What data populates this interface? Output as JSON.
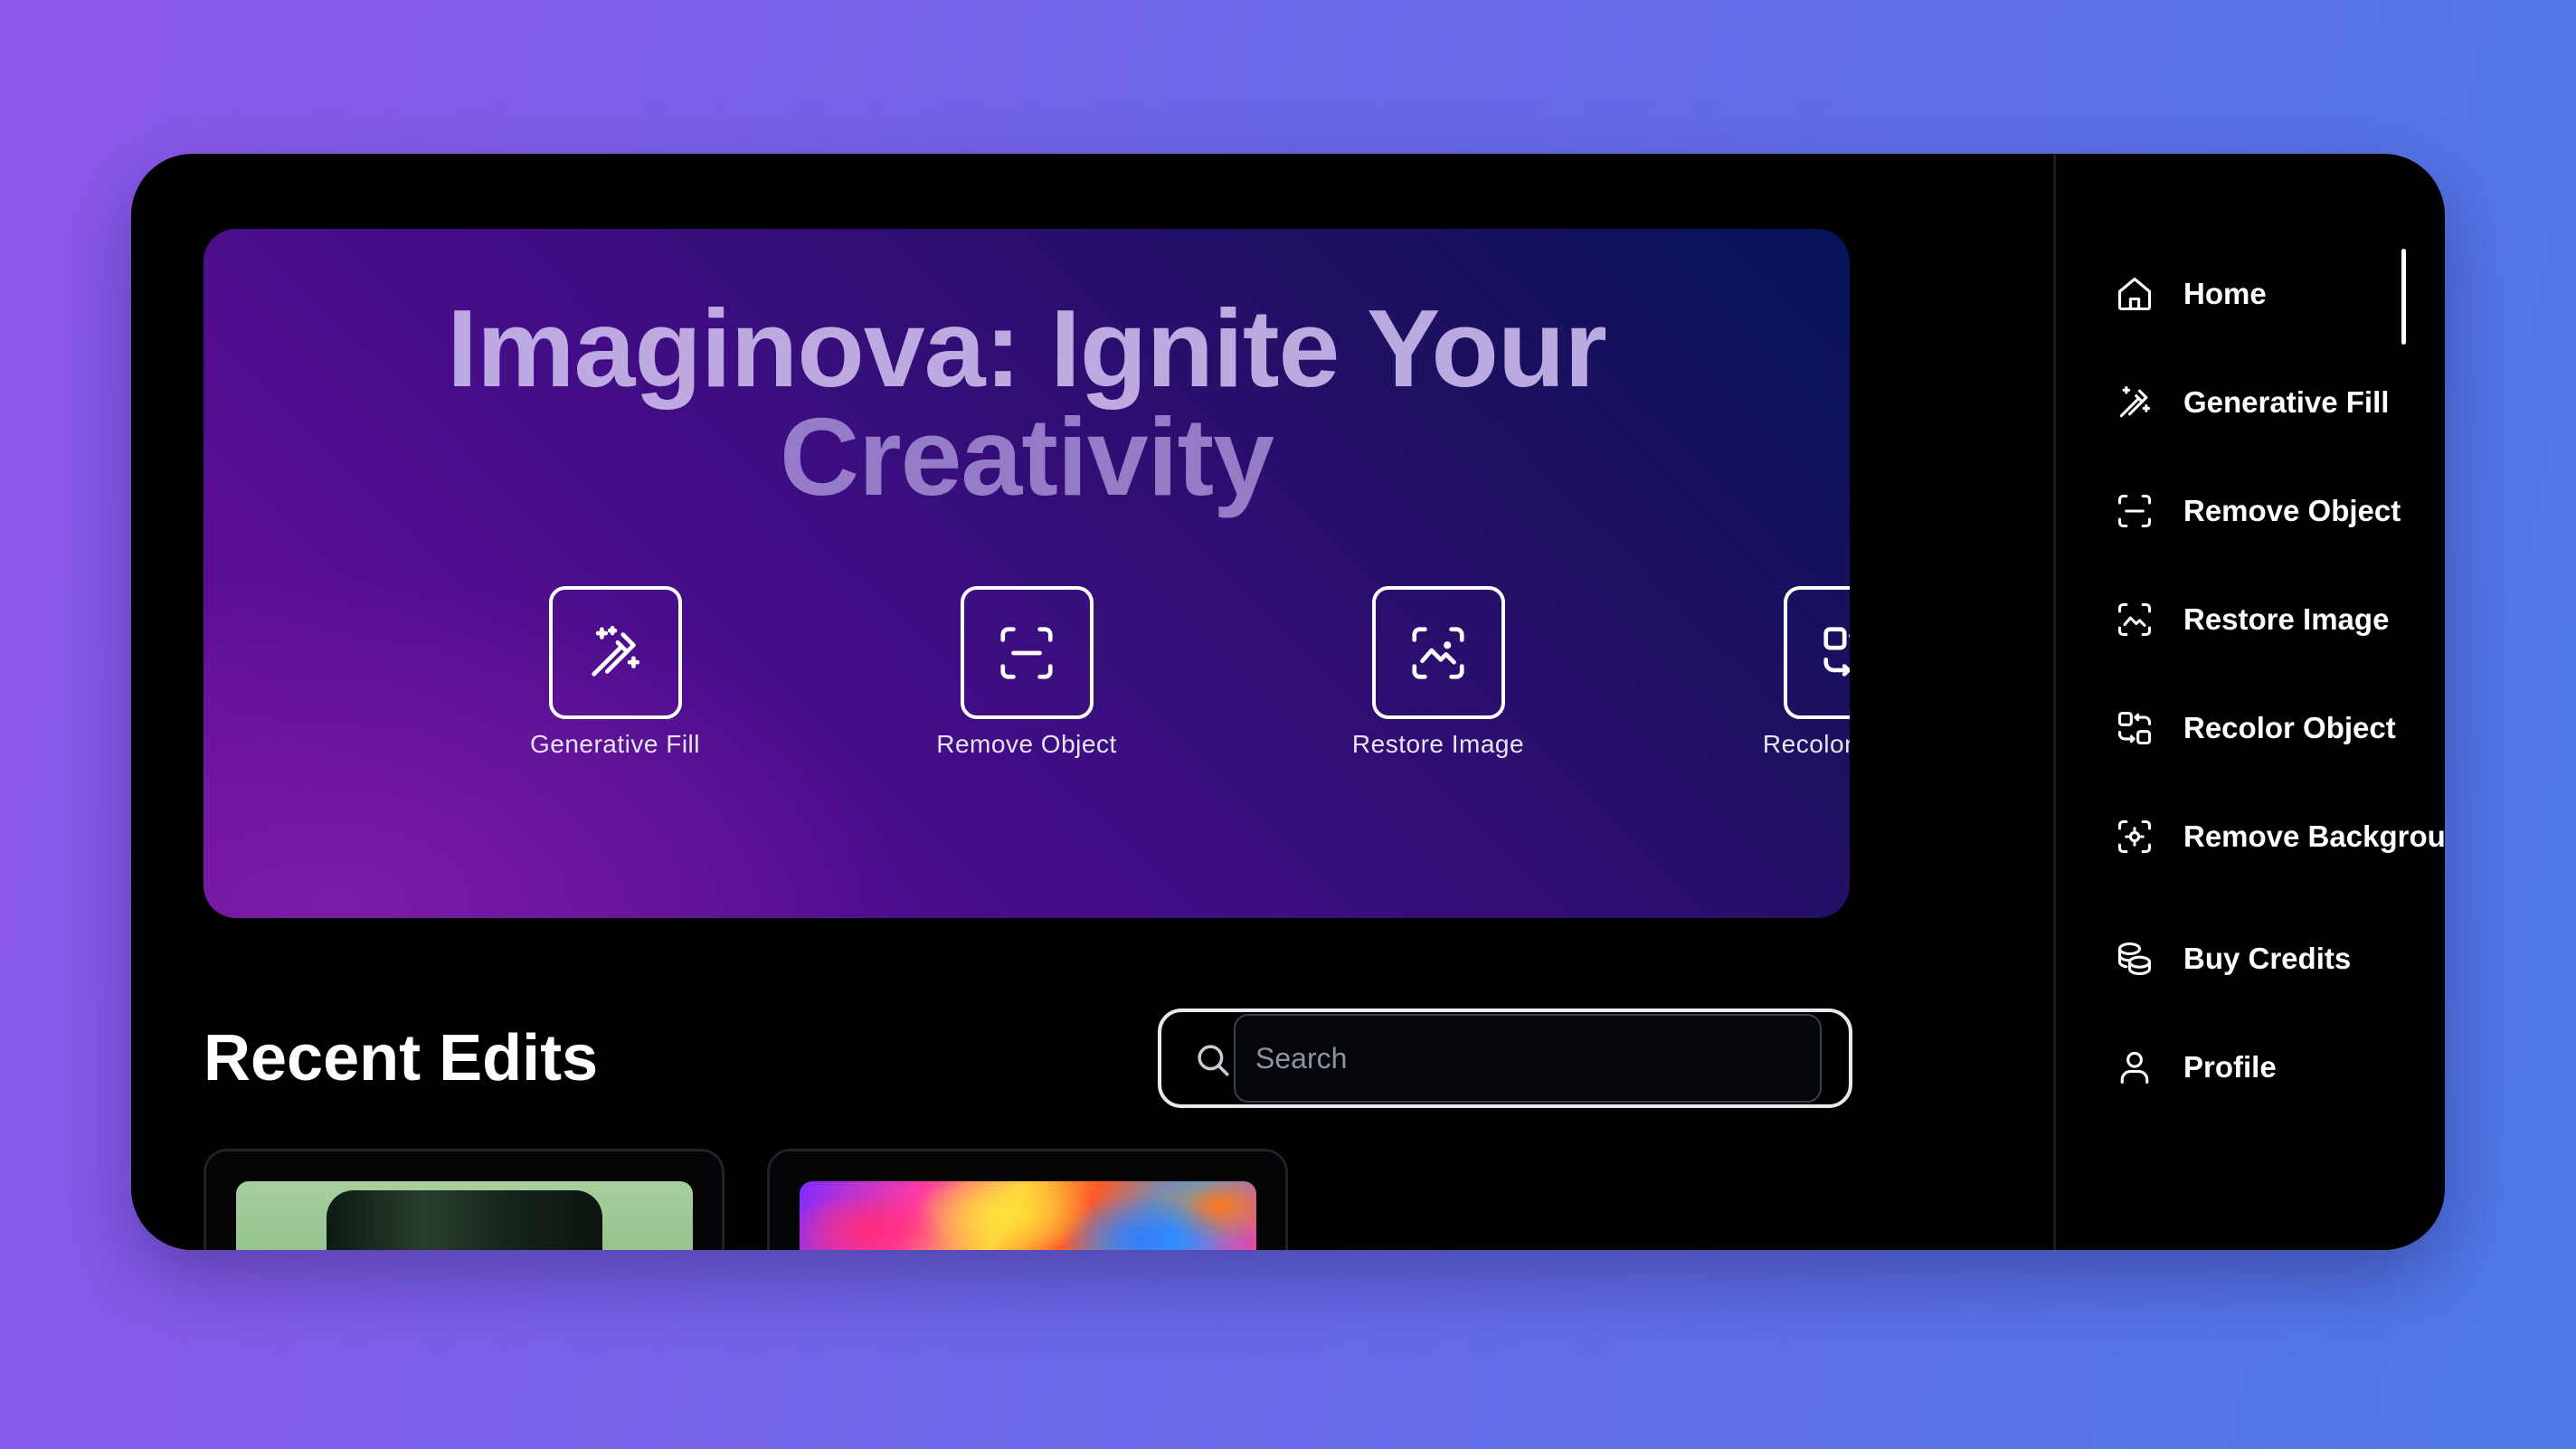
{
  "hero": {
    "title_line1": "Imaginova: Ignite Your",
    "title_line2": "Creativity",
    "tools": [
      {
        "label": "Generative Fill",
        "icon": "wand-icon"
      },
      {
        "label": "Remove Object",
        "icon": "scan-icon"
      },
      {
        "label": "Restore Image",
        "icon": "scan-image-icon"
      },
      {
        "label": "Recolor Object",
        "icon": "swap-shapes-icon"
      }
    ]
  },
  "recent": {
    "title": "Recent Edits",
    "search_placeholder": "Search",
    "cards": [
      {
        "thumbnail": "green-jar-image"
      },
      {
        "thumbnail": "colorful-abstract-image"
      }
    ]
  },
  "sidebar": {
    "items": [
      {
        "label": "Home",
        "icon": "home-icon",
        "active": true
      },
      {
        "label": "Generative Fill",
        "icon": "wand-icon"
      },
      {
        "label": "Remove Object",
        "icon": "scan-icon"
      },
      {
        "label": "Restore Image",
        "icon": "scan-image-icon"
      },
      {
        "label": "Recolor Object",
        "icon": "swap-shapes-icon"
      },
      {
        "label": "Remove Background",
        "icon": "scan-focus-icon"
      },
      {
        "label": "Buy Credits",
        "icon": "coins-icon"
      },
      {
        "label": "Profile",
        "icon": "user-icon"
      }
    ]
  },
  "colors": {
    "background_start": "#8e57ea",
    "background_end": "#4e79e8",
    "panel": "#000000",
    "hero_purple": "#6a0f9e",
    "hero_navy": "#06135a",
    "text": "#ffffff"
  }
}
